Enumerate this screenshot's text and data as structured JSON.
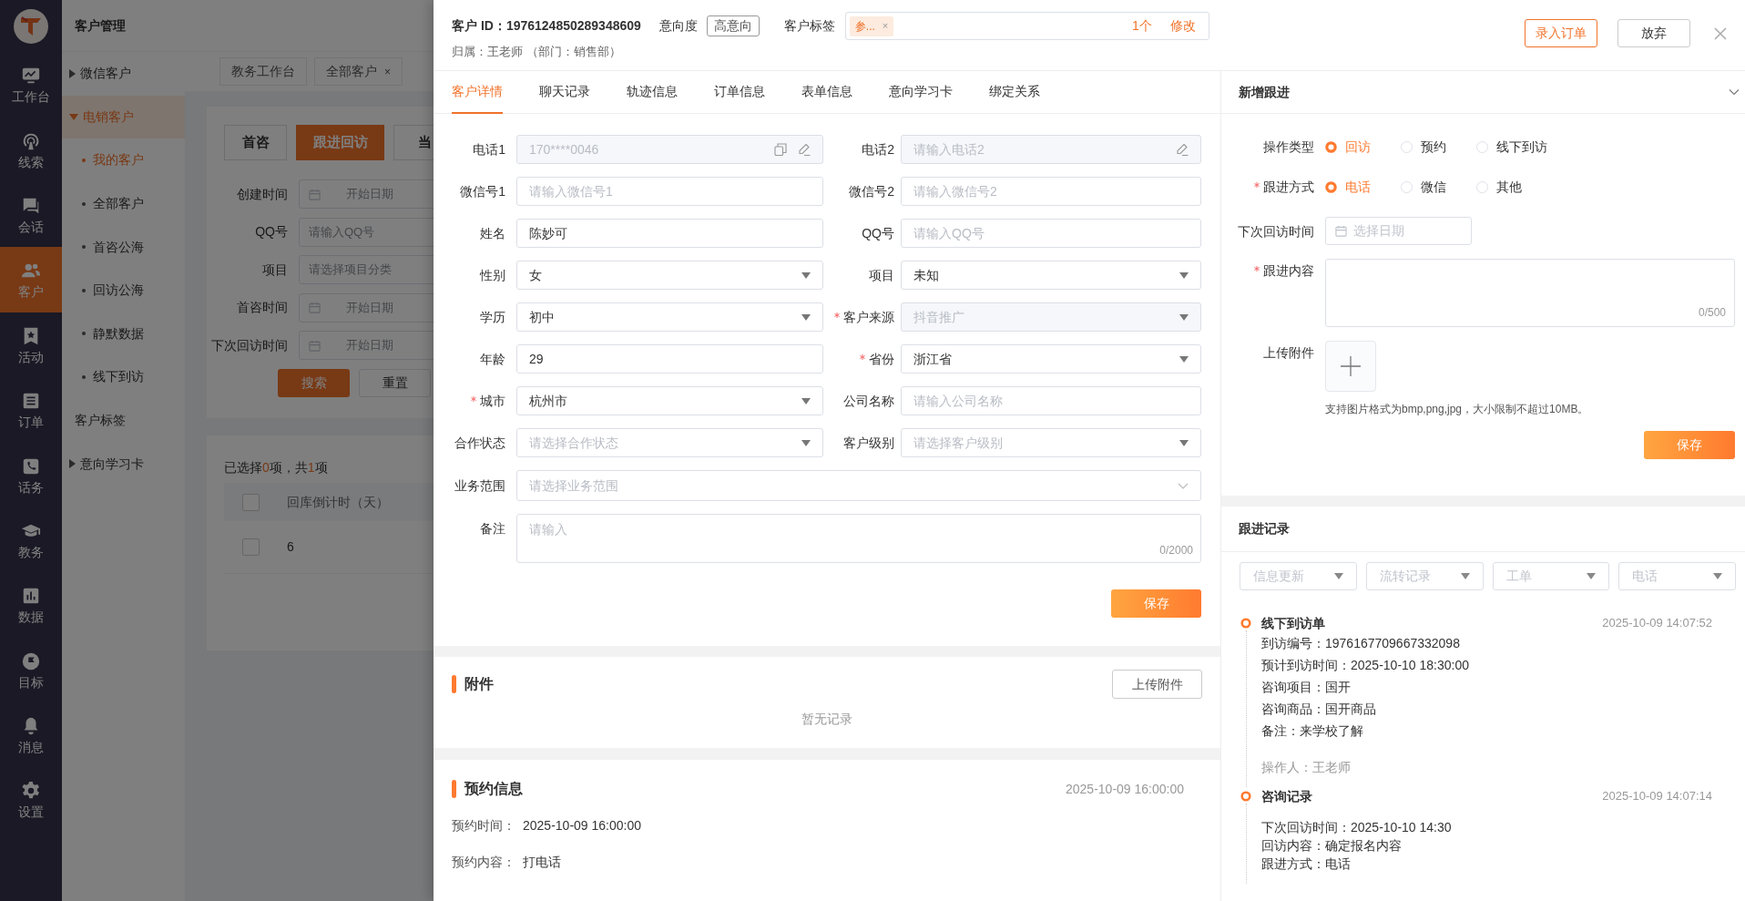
{
  "nav": {
    "items": [
      {
        "label": "工作台",
        "selected": false
      },
      {
        "label": "线索",
        "selected": false
      },
      {
        "label": "会话",
        "selected": false
      },
      {
        "label": "客户",
        "selected": true
      },
      {
        "label": "活动",
        "selected": false
      },
      {
        "label": "订单",
        "selected": false
      },
      {
        "label": "话务",
        "selected": false
      },
      {
        "label": "教务",
        "selected": false
      },
      {
        "label": "数据",
        "selected": false
      },
      {
        "label": "目标",
        "selected": false
      },
      {
        "label": "消息",
        "selected": false
      },
      {
        "label": "设置",
        "selected": false
      }
    ]
  },
  "submenu": {
    "title": "客户管理",
    "items": [
      {
        "label": "微信客户",
        "kind": "group",
        "expanded": false,
        "selected": false
      },
      {
        "label": "电销客户",
        "kind": "group",
        "expanded": true,
        "selected": true,
        "children": [
          {
            "label": "我的客户",
            "selected": true
          },
          {
            "label": "全部客户",
            "selected": false
          },
          {
            "label": "首咨公海",
            "selected": false
          },
          {
            "label": "回访公海",
            "selected": false
          },
          {
            "label": "静默数据",
            "selected": false
          },
          {
            "label": "线下到访",
            "selected": false
          }
        ]
      },
      {
        "label": "客户标签",
        "kind": "link",
        "selected": false
      },
      {
        "label": "意向学习卡",
        "kind": "group",
        "expanded": false,
        "selected": false
      }
    ]
  },
  "page_tabs": [
    {
      "label": "教务工作台"
    },
    {
      "label": "全部客户",
      "close": "×"
    }
  ],
  "sub_tabs": [
    {
      "label": "首咨",
      "selected": false
    },
    {
      "label": "跟进回访",
      "selected": true
    },
    {
      "label": "当",
      "selected": false
    }
  ],
  "filters": [
    {
      "label": "创建时间",
      "kind": "date",
      "placeholder": "开始日期"
    },
    {
      "label": "QQ号",
      "kind": "input",
      "placeholder": "请输入QQ号"
    },
    {
      "label": "项目",
      "kind": "input",
      "placeholder": "请选择项目分类"
    },
    {
      "label": "首咨时间",
      "kind": "date",
      "placeholder": "开始日期"
    },
    {
      "label": "下次回访时间",
      "kind": "date",
      "placeholder": "开始日期"
    }
  ],
  "filter_buttons": [
    {
      "label": "搜索",
      "primary": true
    },
    {
      "label": "重置",
      "primary": false
    }
  ],
  "selection_summary": [
    {
      "text": "已选择",
      "highlight": false
    },
    {
      "text": "0",
      "highlight": true
    },
    {
      "text": "项，共",
      "highlight": false
    },
    {
      "text": "1",
      "highlight": true
    },
    {
      "text": "项",
      "highlight": false
    }
  ],
  "table": {
    "header_checked": false,
    "columns": [
      "回库倒计时（天）"
    ],
    "rows": [
      {
        "checked": false,
        "cells": [
          "6"
        ]
      }
    ]
  },
  "customer": {
    "id_label": "客户 ID：",
    "id": "1976124850289348609",
    "intent_label": "意向度",
    "intent": "高意向",
    "tags_label": "客户标签",
    "tags": [
      {
        "label": "参...",
        "remove": "×"
      }
    ],
    "tag_count": "1个",
    "edit": "修改",
    "owner": "归属：王老师 （部门：销售部）",
    "actions": [
      {
        "label": "录入订单",
        "kind": "primary"
      },
      {
        "label": "放弃",
        "kind": "default"
      }
    ]
  },
  "detail_tabs": [
    {
      "label": "客户详情",
      "selected": true
    },
    {
      "label": "聊天记录",
      "selected": false
    },
    {
      "label": "轨迹信息",
      "selected": false
    },
    {
      "label": "订单信息",
      "selected": false
    },
    {
      "label": "表单信息",
      "selected": false
    },
    {
      "label": "意向学习卡",
      "selected": false
    },
    {
      "label": "绑定关系",
      "selected": false
    }
  ],
  "fields": [
    {
      "label": "电话1",
      "kind": "input",
      "value": "170****0046",
      "disabled": true,
      "copyable": true,
      "editable": true
    },
    {
      "label": "电话2",
      "kind": "input",
      "placeholder": "请输入电话2",
      "disabled": true,
      "editable": true
    },
    {
      "label": "微信号1",
      "kind": "input",
      "placeholder": "请输入微信号1"
    },
    {
      "label": "微信号2",
      "kind": "input",
      "placeholder": "请输入微信号2"
    },
    {
      "label": "姓名",
      "kind": "input",
      "value": "陈妙可"
    },
    {
      "label": "QQ号",
      "kind": "input",
      "placeholder": "请输入QQ号"
    },
    {
      "label": "性别",
      "kind": "select",
      "value": "女"
    },
    {
      "label": "项目",
      "kind": "select",
      "value": "未知"
    },
    {
      "label": "学历",
      "kind": "select",
      "value": "初中"
    },
    {
      "label": "客户来源",
      "kind": "select",
      "value": "抖音推广",
      "required": true,
      "disabled": true
    },
    {
      "label": "年龄",
      "kind": "input",
      "value": "29"
    },
    {
      "label": "省份",
      "kind": "select",
      "value": "浙江省",
      "required": true
    },
    {
      "label": "城市",
      "kind": "select",
      "value": "杭州市",
      "required": true
    },
    {
      "label": "公司名称",
      "kind": "input",
      "placeholder": "请输入公司名称"
    },
    {
      "label": "合作状态",
      "kind": "select",
      "placeholder": "请选择合作状态"
    },
    {
      "label": "客户级别",
      "kind": "select",
      "placeholder": "请选择客户级别"
    },
    {
      "label": "业务范围",
      "kind": "multiselect",
      "placeholder": "请选择业务范围"
    },
    {
      "label": "备注",
      "kind": "textarea",
      "placeholder": "请输入",
      "counter": "0/2000"
    }
  ],
  "detail_save": "保存",
  "attachments": {
    "title": "附件",
    "upload": "上传附件",
    "empty": "暂无记录"
  },
  "appointment": {
    "title": "预约信息",
    "time": "2025-10-09 16:00:00",
    "lines": [
      {
        "label": "预约时间：",
        "value": "2025-10-09 16:00:00"
      },
      {
        "label": "预约内容：",
        "value": "打电话"
      }
    ]
  },
  "new_followup": {
    "title": "新增跟进",
    "expanded": true,
    "rows": [
      {
        "kind": "radio",
        "label": "操作类型",
        "options": [
          {
            "label": "回访",
            "selected": true
          },
          {
            "label": "预约",
            "selected": false
          },
          {
            "label": "线下到访",
            "selected": false
          }
        ]
      },
      {
        "kind": "radio",
        "label": "跟进方式",
        "required": true,
        "options": [
          {
            "label": "电话",
            "selected": true
          },
          {
            "label": "微信",
            "selected": false
          },
          {
            "label": "其他",
            "selected": false
          }
        ]
      },
      {
        "kind": "date",
        "label": "下次回访时间",
        "placeholder": "选择日期"
      },
      {
        "kind": "textarea",
        "label": "跟进内容",
        "required": true,
        "counter": "0/500"
      },
      {
        "kind": "upload",
        "label": "上传附件",
        "hint": "支持图片格式为bmp,png,jpg，大小限制不超过10MB。"
      }
    ],
    "save": "保存"
  },
  "records": {
    "title": "跟进记录",
    "filters": [
      {
        "placeholder": "信息更新"
      },
      {
        "placeholder": "流转记录"
      },
      {
        "placeholder": "工单"
      },
      {
        "placeholder": "电话"
      }
    ],
    "entries": [
      {
        "title": "线下到访单",
        "time": "2025-10-09 14:07:52",
        "lines": [
          "到访编号：1976167709667332098",
          "预计到访时间：2025-10-10 18:30:00",
          "咨询项目：国开",
          "咨询商品：国开商品",
          "备注：来学校了解"
        ],
        "operator": "操作人：王老师"
      },
      {
        "title": "咨询记录",
        "time": "2025-10-09 14:07:14",
        "lines": [
          "下次回访时间：2025-10-10 14:30",
          "回访内容：确定报名内容",
          "跟进方式：电话"
        ]
      }
    ]
  }
}
